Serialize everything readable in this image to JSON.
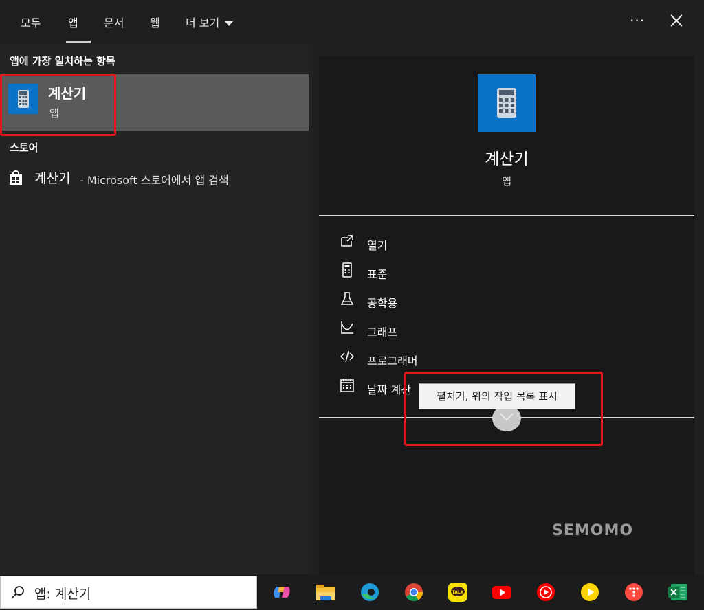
{
  "tabs": [
    {
      "label": "모두"
    },
    {
      "label": "앱"
    },
    {
      "label": "문서"
    },
    {
      "label": "웹"
    },
    {
      "label": "더 보기"
    }
  ],
  "header": {
    "more_label": "···"
  },
  "left": {
    "best_match_title": "앱에 가장 일치하는 항목",
    "best_match": {
      "name": "계산기",
      "type": "앱"
    },
    "store_title": "스토어",
    "store_item": {
      "name": "계산기",
      "suffix": "- Microsoft 스토어에서 앱 검색"
    }
  },
  "detail": {
    "app_name": "계산기",
    "app_type": "앱",
    "actions": [
      {
        "label": "열기",
        "icon": "open-icon"
      },
      {
        "label": "표준",
        "icon": "calculator-icon"
      },
      {
        "label": "공학용",
        "icon": "flask-icon"
      },
      {
        "label": "그래프",
        "icon": "graph-icon"
      },
      {
        "label": "프로그래머",
        "icon": "code-icon"
      },
      {
        "label": "날짜 계산",
        "icon": "calendar-icon"
      }
    ],
    "tooltip": "펼치기, 위의 작업 목록 표시"
  },
  "watermark": "SEMOMO",
  "taskbar": {
    "search_value": "앱: 계산기",
    "apps": [
      "copilot-icon",
      "file-explorer-icon",
      "edge-icon",
      "chrome-icon",
      "kakaotalk-icon",
      "youtube-icon",
      "youtube-music-icon",
      "play-icon",
      "app-icon",
      "excel-icon"
    ]
  },
  "colors": {
    "highlight": "#e0161f",
    "accent": "#0b72c9"
  }
}
